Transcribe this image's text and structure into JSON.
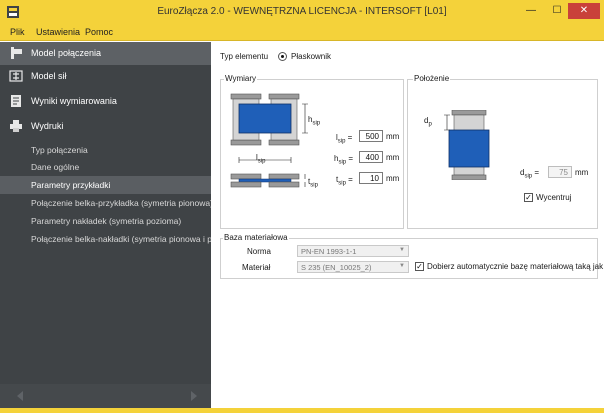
{
  "window": {
    "title": "EuroZłącza 2.0 - WEWNĘTRZNA LICENCJA - INTERSOFT [L01]",
    "minimize": "—",
    "maximize": "☐",
    "close": "✕"
  },
  "menu": [
    "Plik",
    "Ustawienia",
    "Pomoc"
  ],
  "sidebar": {
    "main_items": [
      {
        "label": "Model połączenia",
        "icon": "joint-model-icon"
      },
      {
        "label": "Model sił",
        "icon": "forces-model-icon"
      },
      {
        "label": "Wyniki wymiarowania",
        "icon": "results-icon"
      },
      {
        "label": "Wydruki",
        "icon": "printer-icon"
      }
    ],
    "sub_items": [
      "Typ połączenia",
      "Dane ogólne",
      "Parametry przykładki",
      "Połączenie belka-przykładka (symetria pionowa)",
      "Parametry nakładek (symetria pozioma)",
      "Połączenie belka-nakładki (symetria pionowa i pozioma)"
    ],
    "active_sub": 2
  },
  "element_type": {
    "label": "Typ elementu",
    "option": "Płaskownik"
  },
  "dimensions": {
    "title": "Wymiary",
    "fields": [
      {
        "label": "l",
        "sub": "sip",
        "value": "500",
        "unit": "mm"
      },
      {
        "label": "h",
        "sub": "sip",
        "value": "400",
        "unit": "mm"
      },
      {
        "label": "t",
        "sub": "sip",
        "value": "10",
        "unit": "mm"
      }
    ],
    "diagram_labels": {
      "h": "h",
      "l": "l",
      "t": "t",
      "sub": "sip"
    }
  },
  "position": {
    "title": "Położenie",
    "d_label": "d",
    "d_sub": "sip",
    "d_value": "75",
    "d_unit": "mm",
    "dp_label": "d",
    "dp_sub": "p",
    "center_label": "Wycentruj",
    "center_checked": true
  },
  "material": {
    "title": "Baza materiałowa",
    "norm_label": "Norma",
    "norm_value": "PN-EN 1993-1-1",
    "material_label": "Materiał",
    "material_value": "S 235 (EN_10025_2)",
    "auto_label": "Dobierz automatycznie bazę materiałową taką jak belka",
    "auto_checked": true
  },
  "colors": {
    "accent": "#f4d23a",
    "sidebar": "#3f4346",
    "plate": "#1f5fb8",
    "steel": "#9a9a9a"
  }
}
